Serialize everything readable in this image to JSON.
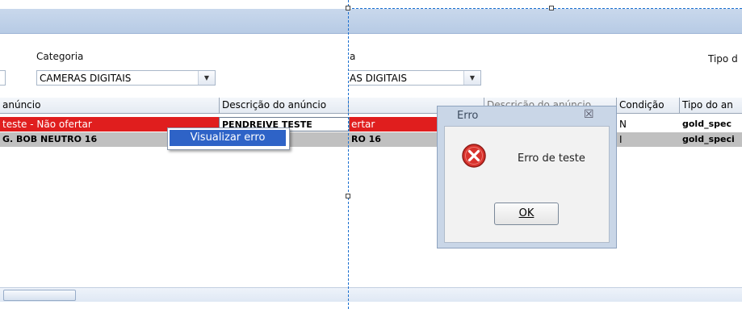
{
  "header": {
    "categoria_label": "Categoria",
    "categoria_value": "CAMERAS DIGITAIS",
    "categoria2_label_partial": "a",
    "categoria2_value_partial": "AS DIGITAIS",
    "tipo_label_partial": "Tipo d"
  },
  "grid": {
    "columns": [
      {
        "label": "anúncio"
      },
      {
        "label": "Descrição do anúncio"
      },
      {
        "label": ""
      },
      {
        "label": "Descrição do anúncio"
      },
      {
        "label": "Condição"
      },
      {
        "label": "Tipo do an"
      }
    ],
    "rows": [
      {
        "c1": "teste - Não ofertar",
        "c2": "PENDREIVE TESTE",
        "c3": "ertar",
        "c5": "N",
        "c6": "gold_spec",
        "color": "#e01e1e"
      },
      {
        "c1": "G. BOB NEUTRO 16",
        "c2": "",
        "c3": "RO 16",
        "c5": "I",
        "c6": "gold_speci",
        "color": "#c0c0c0"
      }
    ]
  },
  "context_menu": {
    "items": [
      {
        "label": "Visualizar erro"
      }
    ]
  },
  "dialog": {
    "title": "Erro",
    "message": "Erro de teste",
    "ok_label": "OK",
    "icon": "error-icon"
  },
  "colors": {
    "error_row": "#e01e1e",
    "selection": "#2e63c7",
    "guide": "#1a6fd0"
  }
}
